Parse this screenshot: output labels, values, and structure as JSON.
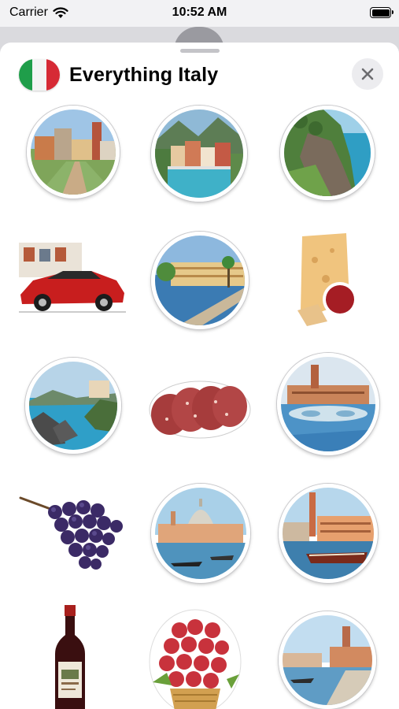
{
  "status_bar": {
    "carrier": "Carrier",
    "time": "10:52 AM"
  },
  "header": {
    "title": "Everything Italy",
    "close_icon": "close-icon",
    "flag_colors": [
      "#1f9e4a",
      "#ffffff",
      "#d62a35"
    ]
  },
  "stickers": [
    {
      "name": "sticker-village-square",
      "icon": "village-square"
    },
    {
      "name": "sticker-lakeside-town",
      "icon": "lakeside-town"
    },
    {
      "name": "sticker-coastal-cliffs",
      "icon": "coastal-cliffs"
    },
    {
      "name": "sticker-red-sports-car",
      "icon": "sports-car"
    },
    {
      "name": "sticker-riviera-promenade",
      "icon": "riviera-promenade"
    },
    {
      "name": "sticker-cheese-wedge",
      "icon": "cheese"
    },
    {
      "name": "sticker-bay-rocks",
      "icon": "bay-rocks"
    },
    {
      "name": "sticker-salami-slices",
      "icon": "salami"
    },
    {
      "name": "sticker-piazza-fountain",
      "icon": "piazza-fountain"
    },
    {
      "name": "sticker-grapes",
      "icon": "grapes"
    },
    {
      "name": "sticker-venice-dome",
      "icon": "venice-dome"
    },
    {
      "name": "sticker-venice-gondola",
      "icon": "venice-gondola"
    },
    {
      "name": "sticker-wine-bottle",
      "icon": "wine-bottle"
    },
    {
      "name": "sticker-grape-basket",
      "icon": "grape-basket"
    },
    {
      "name": "sticker-canal-street",
      "icon": "canal-street"
    }
  ]
}
